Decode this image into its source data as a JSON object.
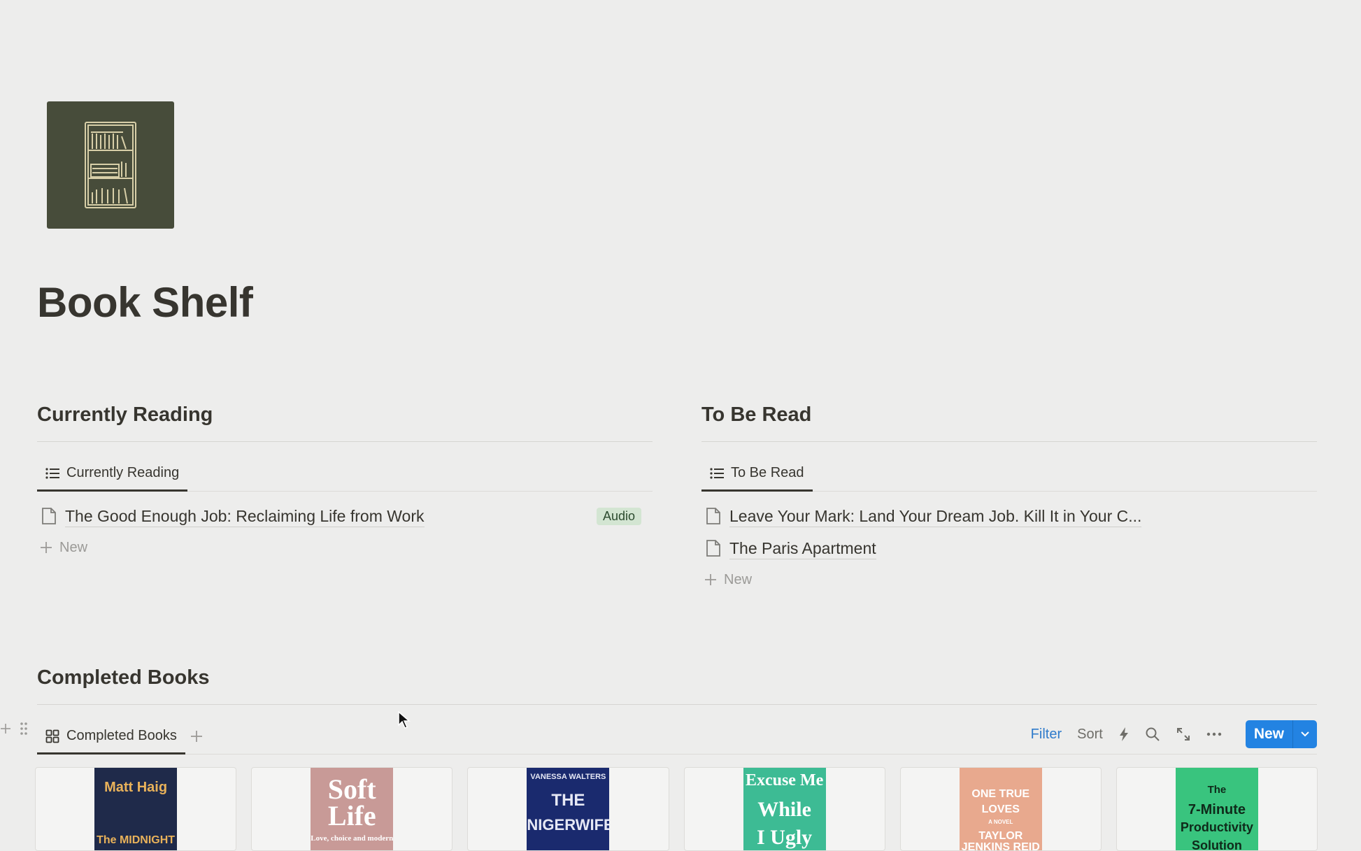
{
  "page": {
    "title": "Book Shelf",
    "icon": "bookshelf-icon"
  },
  "currently_reading": {
    "heading": "Currently Reading",
    "tab_label": "Currently Reading",
    "rows": [
      {
        "title": "The Good Enough Job: Reclaiming Life from Work",
        "tag": "Audio"
      }
    ],
    "new_label": "New"
  },
  "to_be_read": {
    "heading": "To Be Read",
    "tab_label": "To Be Read",
    "rows": [
      {
        "title": "Leave Your Mark: Land Your Dream Job. Kill It in Your C..."
      },
      {
        "title": "The Paris Apartment"
      }
    ],
    "new_label": "New"
  },
  "completed": {
    "heading": "Completed Books",
    "tab_label": "Completed Books",
    "toolbar": {
      "filter": "Filter",
      "sort": "Sort",
      "new": "New"
    },
    "covers": [
      {
        "lines": [
          "Matt Haig",
          "The MIDNIGHT"
        ],
        "bg": "#1f2a4a",
        "fg": "#e9b25a"
      },
      {
        "lines": [
          "Soft",
          "Life",
          "Love, choice and modern"
        ],
        "bg": "#c89a97",
        "fg": "#ffffff"
      },
      {
        "lines": [
          "VANESSA WALTERS",
          "THE",
          "NIGERWIFE"
        ],
        "bg": "#1a2a6e",
        "fg": "#e6e8f5"
      },
      {
        "lines": [
          "Excuse Me",
          "While",
          "I Ugly"
        ],
        "bg": "#3dbb94",
        "fg": "#ffffff"
      },
      {
        "lines": [
          "ONE TRUE",
          "LOVES",
          "A NOVEL",
          "TAYLOR",
          "JENKINS REID"
        ],
        "bg": "#e8a98e",
        "fg": "#ffffff"
      },
      {
        "lines": [
          "The",
          "7-Minute",
          "Productivity",
          "Solution"
        ],
        "bg": "#39c47e",
        "fg": "#0f2a1a"
      }
    ]
  },
  "colors": {
    "accent": "#2383e2",
    "tag_bg": "#d3e5d2",
    "icon_bg": "#474c3a",
    "filter": "#2f7bcb"
  }
}
